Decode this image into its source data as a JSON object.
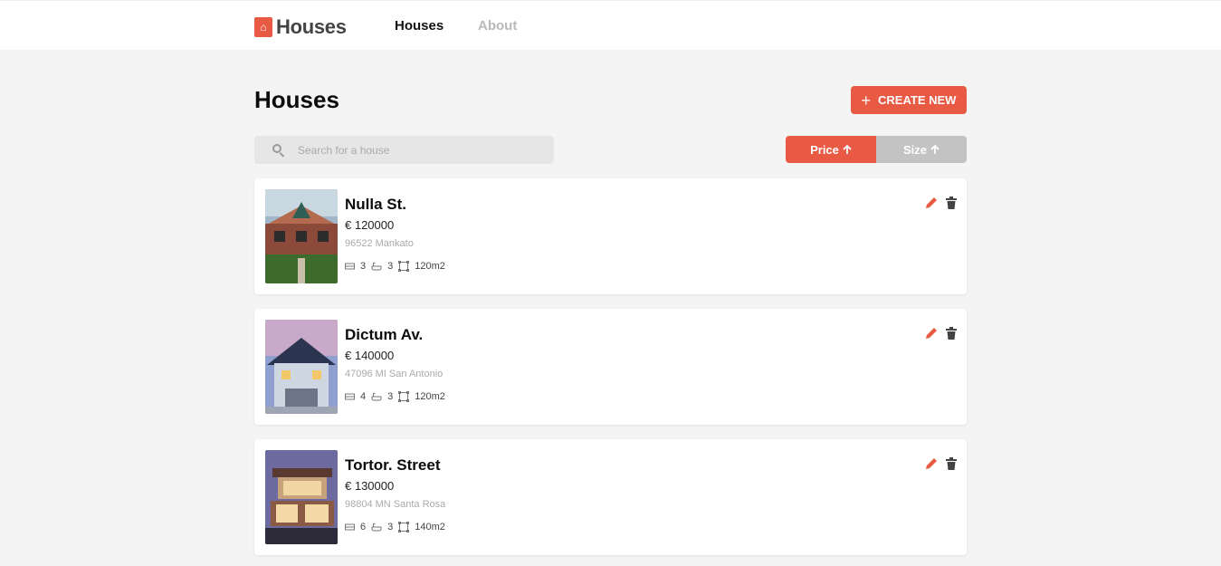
{
  "header": {
    "logo_text": "Houses",
    "nav": [
      {
        "label": "Houses"
      },
      {
        "label": "About"
      }
    ]
  },
  "main": {
    "title": "Houses",
    "create_label": "CREATE NEW",
    "search": {
      "placeholder": "Search for a house",
      "value": ""
    },
    "sort": [
      {
        "label": "Price",
        "active": true
      },
      {
        "label": "Size",
        "active": false
      }
    ]
  },
  "houses": [
    {
      "title": "Nulla St.",
      "price": "€ 120000",
      "address": "96522 Mankato",
      "bedrooms": "3",
      "bathrooms": "3",
      "size": "120m2"
    },
    {
      "title": "Dictum Av.",
      "price": "€ 140000",
      "address": "47096 MI San Antonio",
      "bedrooms": "4",
      "bathrooms": "3",
      "size": "120m2"
    },
    {
      "title": "Tortor. Street",
      "price": "€ 130000",
      "address": "98804 MN Santa Rosa",
      "bedrooms": "6",
      "bathrooms": "3",
      "size": "140m2"
    }
  ],
  "colors": {
    "accent": "#e85a44",
    "inactive": "#c3c3c3",
    "background": "#f4f4f4"
  }
}
